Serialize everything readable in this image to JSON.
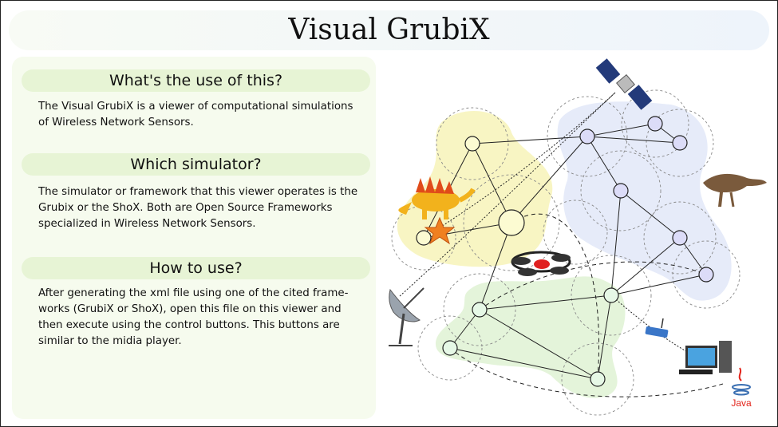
{
  "title": "Visual GrubiX",
  "sections": [
    {
      "heading": "What's the use of this?",
      "lines": [
        "The Visual GrubiX is a viewer of computational simulations",
        "of Wireless Network Sensors."
      ]
    },
    {
      "heading": "Which simulator?",
      "lines": [
        "The simulator or framework that this viewer operates is the",
        "Grubix or the ShoX. Both are Open Source Frameworks",
        "specialized in Wireless Network Sensors."
      ]
    },
    {
      "heading": "How to use?",
      "lines": [
        "After generating the xml file using one of the cited frame-",
        "works (GrubiX or ShoX), open this file on this viewer and",
        "then execute using the control buttons. This buttons are",
        "similar to the midia player."
      ]
    }
  ],
  "java_logo_text": "Java",
  "colors": {
    "yellow_node": "#fcfbd2",
    "blue_node": "#dcdcf8",
    "green_node": "#e6f8e6",
    "yellow_region": "#f7f3b8",
    "blue_region": "#e3e9f8",
    "green_region": "#e1f3d6",
    "java_red": "#e2231a",
    "java_blue": "#3a6fb2"
  },
  "icons": [
    "satellite-icon",
    "stegosaurus-icon",
    "velociraptor-icon",
    "quadcopter-drone-icon",
    "satellite-dish-icon",
    "wireless-router-icon",
    "desktop-computer-icon",
    "java-logo-icon",
    "star-icon"
  ]
}
